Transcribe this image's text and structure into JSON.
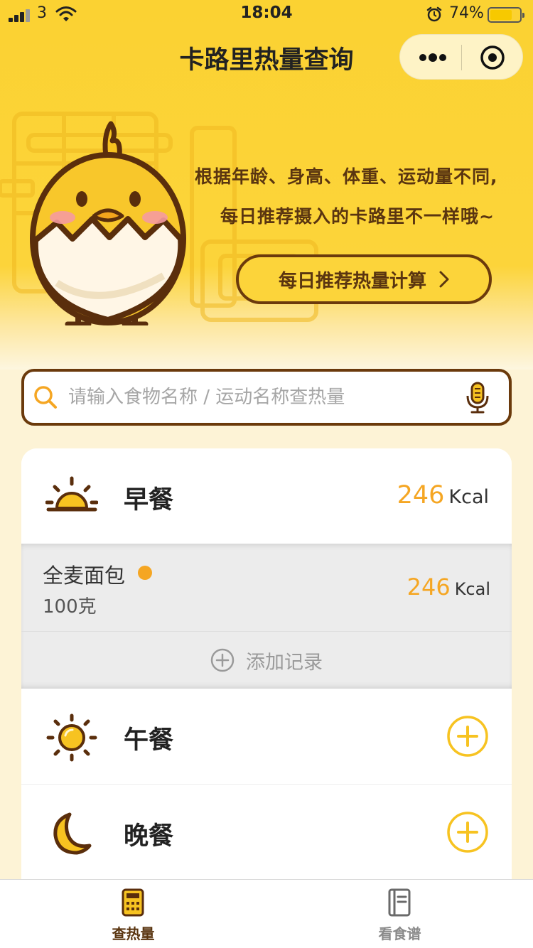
{
  "status_bar": {
    "carrier": "3",
    "time": "18:04",
    "battery_percent": "74%",
    "battery_level": 0.74
  },
  "nav": {
    "title": "卡路里热量查询",
    "more_icon": "more-dots-icon",
    "close_icon": "target-close-icon"
  },
  "hero": {
    "line1": "根据年龄、身高、体重、运动量不同,",
    "line2": "每日推荐摄入的卡路里不一样哦~",
    "calc_button": "每日推荐热量计算"
  },
  "search": {
    "placeholder": "请输入食物名称 / 运动名称查热量",
    "value": ""
  },
  "meals": {
    "breakfast": {
      "name": "早餐",
      "calories": "246",
      "unit": "Kcal",
      "items": [
        {
          "name": "全麦面包",
          "amount": "100克",
          "calories": "246",
          "unit": "Kcal"
        }
      ],
      "add_record": "添加记录"
    },
    "lunch": {
      "name": "午餐"
    },
    "dinner": {
      "name": "晚餐"
    }
  },
  "tabbar": {
    "tabs": [
      {
        "label": "查热量",
        "icon": "calculator-icon",
        "active": true
      },
      {
        "label": "看食谱",
        "icon": "recipe-book-icon",
        "active": false
      }
    ]
  },
  "colors": {
    "primary_yellow": "#fcd43a",
    "brown": "#6b3a0c",
    "accent_orange": "#f5a623",
    "add_yellow": "#f7c321"
  }
}
